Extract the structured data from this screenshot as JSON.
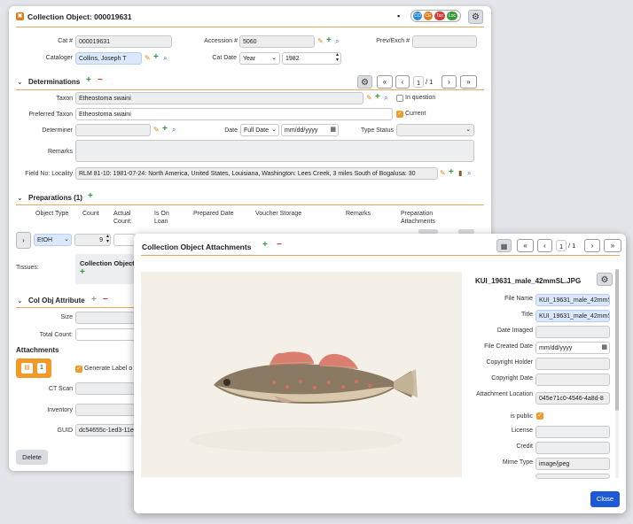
{
  "main": {
    "title": "Collection Object: 000019631",
    "cat_num_label": "Cat #",
    "cat_num": "000019631",
    "accession_label": "Accession #",
    "accession": "5060",
    "prevexch_label": "Prev/Exch #",
    "cataloger_label": "Cataloger",
    "cataloger": "Collins, Joseph T",
    "catdate_label": "Cat Date",
    "catdate_precision": "Year",
    "catdate_value": "1982",
    "badges": [
      "CO",
      "CE",
      "Tax",
      "Loc"
    ]
  },
  "determinations": {
    "title": "Determinations",
    "page_current": "1",
    "page_total": "/ 1",
    "taxon_label": "Taxon",
    "taxon": "Etheostoma swaini",
    "in_question_label": "In question",
    "preferred_taxon_label": "Preferred Taxon",
    "preferred_taxon": "Etheostoma swaini",
    "current_label": "Current",
    "determiner_label": "Determiner",
    "date_label": "Date",
    "date_precision": "Full Date",
    "date_placeholder": "mm/dd/yyyy",
    "type_status_label": "Type Status",
    "remarks_label": "Remarks",
    "field_locality_label": "Field No: Locality",
    "field_locality": "RLM 81-10: 1981-07-24: North America, United States, Louisiana, Washington: Lees Creek, 3 miles South of Bogalusa: 30"
  },
  "preparations": {
    "title": "Preparations (1)",
    "headers": [
      "Object Type",
      "Count",
      "Actual Count:",
      "Is On Loan",
      "Prepared Date",
      "Voucher Storage",
      "Remarks",
      "Preparation Attachments"
    ],
    "object_type": "EtOH",
    "count": "9",
    "tissues_label": "Tissues:",
    "tissues_sub": "Collection Object"
  },
  "col_obj_attribute": {
    "title": "Col Obj Attribute",
    "size_label": "Size",
    "total_count_label": "Total Count:"
  },
  "attachments": {
    "title": "Attachments",
    "count": "1",
    "generate_label": "Generate Label o",
    "ct_scan_label": "CT Scan",
    "inventory_label": "Inventory",
    "guid_label": "GUID",
    "guid": "dc54655c-1ed3-11e"
  },
  "delete_label": "Delete",
  "dialog": {
    "title": "Collection Object Attachments",
    "page_current": "1",
    "page_total": "/ 1",
    "filename": "KUI_19631_male_42mmSL.JPG",
    "fields": [
      {
        "label": "File Name",
        "value": "KUI_19631_male_42mmS",
        "style": "blue"
      },
      {
        "label": "Title",
        "value": "KUI_19631_male_42mmS",
        "style": "blue"
      },
      {
        "label": "Date Imaged",
        "value": "",
        "style": "grey"
      },
      {
        "label": "File Created Date",
        "value": "mm/dd/yyyy",
        "style": "date"
      },
      {
        "label": "Copyright Holder",
        "value": "",
        "style": "grey"
      },
      {
        "label": "Copyright Date",
        "value": "",
        "style": "grey"
      },
      {
        "label": "Attachment Location",
        "value": "045e71c0-4546-4a8d-8",
        "style": "grey"
      },
      {
        "label": "is public",
        "value": "",
        "style": "check"
      },
      {
        "label": "License",
        "value": "",
        "style": "grey"
      },
      {
        "label": "Credit",
        "value": "",
        "style": "grey"
      },
      {
        "label": "Mime Type",
        "value": "image/jpeg",
        "style": "grey"
      }
    ],
    "close_label": "Close"
  },
  "colors": {
    "accent": "#f19a28",
    "blue": "#2b6fd6",
    "close": "#1f5ad6"
  }
}
